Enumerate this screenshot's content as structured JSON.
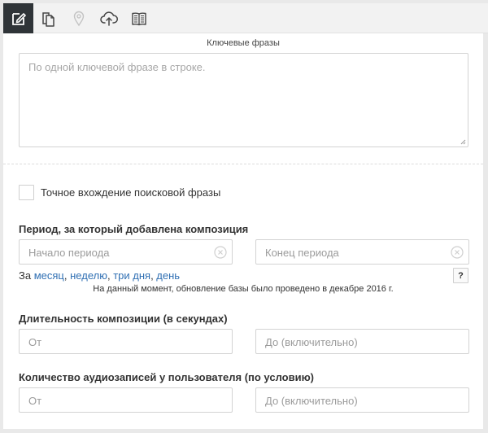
{
  "toolbar": {
    "icons": [
      {
        "name": "edit-icon",
        "active": true
      },
      {
        "name": "documents-icon",
        "active": false
      },
      {
        "name": "location-pin-icon",
        "active": false,
        "disabled": true
      },
      {
        "name": "cloud-upload-icon",
        "active": false
      },
      {
        "name": "book-icon",
        "active": false
      }
    ]
  },
  "keywords": {
    "title": "Ключевые фразы",
    "placeholder": "По одной ключевой фразе в строке."
  },
  "exact_match": {
    "label": "Точное вхождение поисковой фразы",
    "checked": false
  },
  "period": {
    "label": "Период, за который добавлена композиция",
    "start_placeholder": "Начало периода",
    "end_placeholder": "Конец периода",
    "quick_prefix": "За",
    "quick_links": [
      "месяц",
      "неделю",
      "три дня",
      "день"
    ],
    "help_label": "?",
    "notice": "На данный момент, обновление базы было проведено в декабре 2016 г."
  },
  "duration": {
    "label": "Длительность композиции (в секундах)",
    "from_placeholder": "От",
    "to_placeholder": "До (включительно)"
  },
  "audio_count": {
    "label": "Количество аудиозаписей у пользователя (по условию)",
    "from_placeholder": "От",
    "to_placeholder": "До (включительно)"
  },
  "colors": {
    "toolbar_active": "#2f3438",
    "link": "#2f6fb3"
  }
}
